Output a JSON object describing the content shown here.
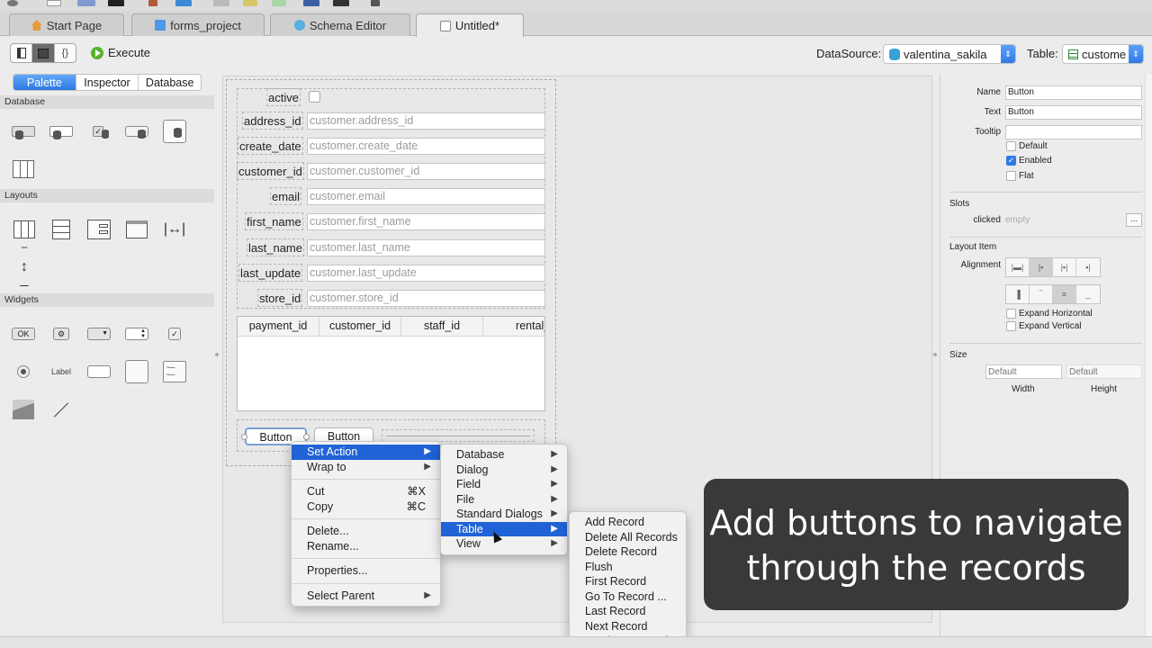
{
  "tabs": [
    {
      "label": "Start Page",
      "icon": "home-icon"
    },
    {
      "label": "forms_project",
      "icon": "file-icon"
    },
    {
      "label": "Schema Editor",
      "icon": "schema-icon"
    },
    {
      "label": "Untitled*",
      "icon": "form-window-icon",
      "active": true
    }
  ],
  "toolbar": {
    "view_modes": [
      "sidebar-view",
      "form-view",
      "code-view"
    ],
    "view_mode_code_glyph": "{}",
    "execute_label": "Execute",
    "datasource_label": "DataSource:",
    "datasource_value": "valentina_sakila",
    "table_label": "Table:",
    "table_value": "custome",
    "accent_color": "#2f7be6"
  },
  "left_panel": {
    "tabs": [
      "Palette",
      "Inspector",
      "Database"
    ],
    "active_tab": "Palette",
    "sections": [
      {
        "title": "Database",
        "items": [
          "db-combobox-icon",
          "db-spinbox-icon",
          "db-checkbox-icon",
          "db-lineedit-icon",
          "db-textedit-icon",
          "db-table-icon"
        ]
      },
      {
        "title": "Layouts",
        "items": [
          "horizontal-layout-icon",
          "vertical-layout-icon",
          "form-layout-icon",
          "tab-widget-icon",
          "horizontal-spacer-icon",
          "vertical-spacer-icon"
        ]
      },
      {
        "title": "Widgets",
        "items": [
          "push-button-icon",
          "tool-button-icon",
          "combobox-icon",
          "spinbox-icon",
          "checkbox-icon",
          "radio-button-icon",
          "label-icon",
          "line-edit-icon",
          "text-edit-icon",
          "list-view-icon",
          "image-icon",
          "line-icon"
        ]
      }
    ],
    "ok_glyph": "OK",
    "label_glyph": "Label"
  },
  "form": {
    "fields": [
      {
        "label": "active",
        "type": "checkbox"
      },
      {
        "label": "address_id",
        "placeholder": "customer.address_id"
      },
      {
        "label": "create_date",
        "placeholder": "customer.create_date"
      },
      {
        "label": "customer_id",
        "placeholder": "customer.customer_id"
      },
      {
        "label": "email",
        "placeholder": "customer.email"
      },
      {
        "label": "first_name",
        "placeholder": "customer.first_name"
      },
      {
        "label": "last_name",
        "placeholder": "customer.last_name"
      },
      {
        "label": "last_update",
        "placeholder": "customer.last_update"
      },
      {
        "label": "store_id",
        "placeholder": "customer.store_id"
      }
    ],
    "grid_columns": [
      "payment_id",
      "customer_id",
      "staff_id",
      "rental_id"
    ],
    "buttons": [
      "Button",
      "Button"
    ]
  },
  "context_menu": {
    "items": [
      {
        "label": "Set Action",
        "submenu": true,
        "highlighted": true
      },
      {
        "label": "Wrap to",
        "submenu": true
      },
      {
        "sep": true
      },
      {
        "label": "Cut",
        "shortcut": "⌘X"
      },
      {
        "label": "Copy",
        "shortcut": "⌘C"
      },
      {
        "sep": true
      },
      {
        "label": "Delete..."
      },
      {
        "label": "Rename..."
      },
      {
        "sep": true
      },
      {
        "label": "Properties..."
      },
      {
        "sep": true
      },
      {
        "label": "Select Parent",
        "submenu": true
      }
    ]
  },
  "action_submenu": {
    "items": [
      {
        "label": "Database",
        "submenu": true
      },
      {
        "label": "Dialog",
        "submenu": true
      },
      {
        "label": "Field",
        "submenu": true
      },
      {
        "label": "File",
        "submenu": true
      },
      {
        "label": "Standard Dialogs",
        "submenu": true
      },
      {
        "label": "Table",
        "submenu": true,
        "highlighted": true
      },
      {
        "label": "View",
        "submenu": true
      }
    ]
  },
  "table_submenu": {
    "items": [
      "Add Record",
      "Delete All Records",
      "Delete Record",
      "Flush",
      "First Record",
      "Go To Record ...",
      "Last Record",
      "Next Record",
      "Previous Record"
    ]
  },
  "inspector": {
    "name_label": "Name",
    "name_value": "Button",
    "text_label": "Text",
    "text_value": "Button",
    "tooltip_label": "Tooltip",
    "tooltip_value": "",
    "checkboxes": [
      {
        "label": "Default",
        "checked": false
      },
      {
        "label": "Enabled",
        "checked": true
      },
      {
        "label": "Flat",
        "checked": false
      }
    ],
    "slots_title": "Slots",
    "slot_name": "clicked",
    "slot_value": "empty",
    "slot_button": "...",
    "layout_title": "Layout Item",
    "alignment_label": "Alignment",
    "h_align_options": [
      "justify",
      "left",
      "center",
      "right"
    ],
    "h_align_selected": "left",
    "v_align_options": [
      "stretch",
      "top",
      "center",
      "bottom"
    ],
    "v_align_selected": "center",
    "expand_checks": [
      {
        "label": "Expand Horizontal",
        "checked": false
      },
      {
        "label": "Expand Vertical",
        "checked": false
      }
    ],
    "size_title": "Size",
    "width_placeholder": "Default",
    "height_placeholder": "Default",
    "width_label": "Width",
    "height_label": "Height"
  },
  "caption": {
    "line1": "Add buttons to navigate",
    "line2": "through the records"
  }
}
